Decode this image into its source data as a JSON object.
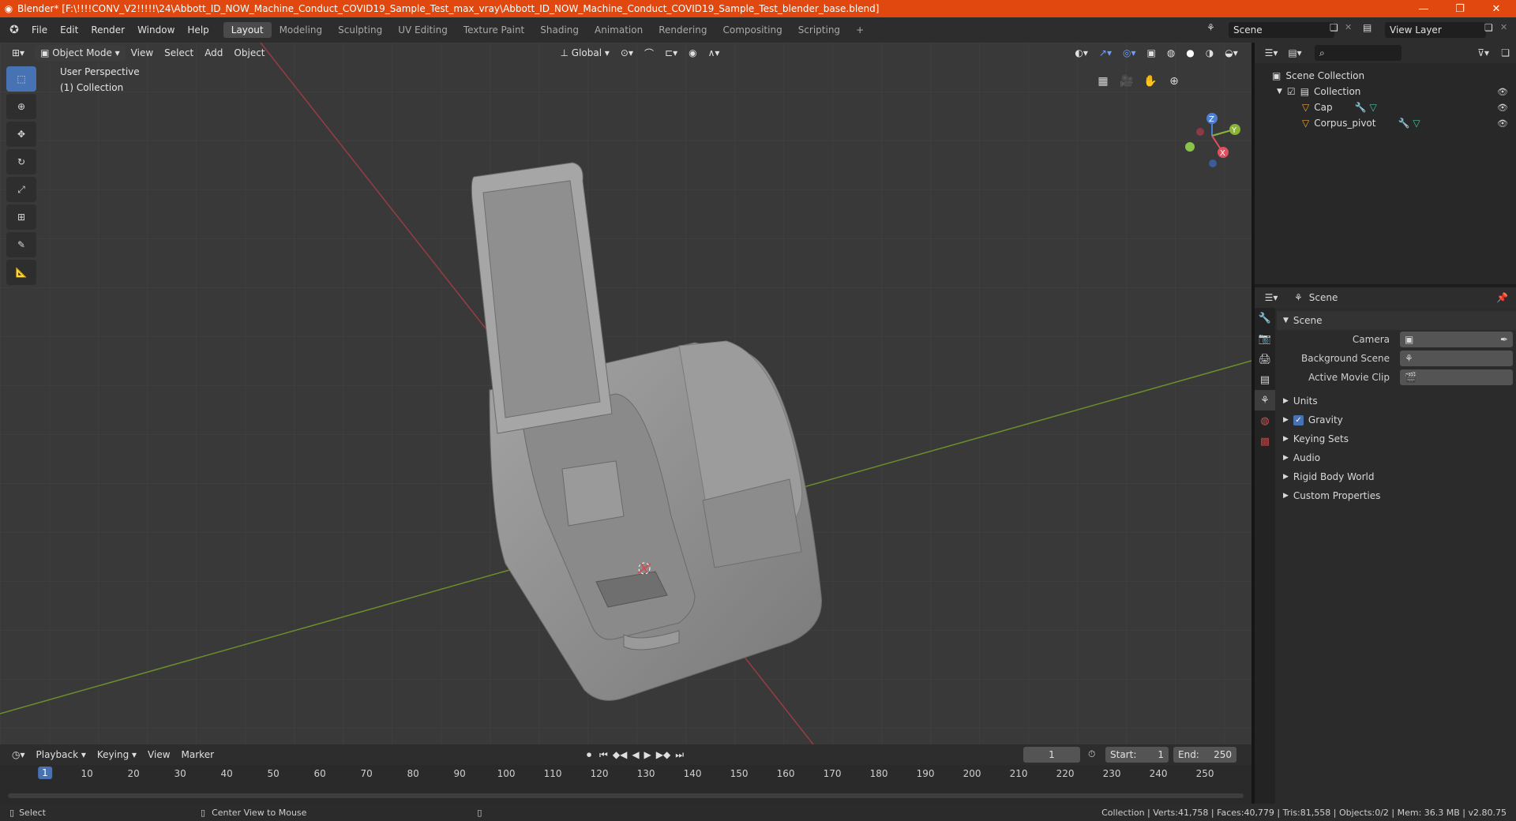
{
  "window": {
    "title": "Blender* [F:\\!!!!CONV_V2!!!!!\\24\\Abbott_ID_NOW_Machine_Conduct_COVID19_Sample_Test_max_vray\\Abbott_ID_NOW_Machine_Conduct_COVID19_Sample_Test_blender_base.blend]",
    "minimize": "—",
    "restore": "❐",
    "close": "✕"
  },
  "menu": [
    "File",
    "Edit",
    "Render",
    "Window",
    "Help"
  ],
  "workspaces": [
    "Layout",
    "Modeling",
    "Sculpting",
    "UV Editing",
    "Texture Paint",
    "Shading",
    "Animation",
    "Rendering",
    "Compositing",
    "Scripting",
    "+"
  ],
  "active_workspace": "Layout",
  "scene_field": "Scene",
  "view_layer_field": "View Layer",
  "viewport": {
    "mode": "Object Mode",
    "menus": [
      "View",
      "Select",
      "Add",
      "Object"
    ],
    "orientation": "Global",
    "perspective_label": "User Perspective",
    "collection_label": "(1) Collection",
    "gizmo": {
      "x": "X",
      "y": "Y",
      "z": "Z"
    }
  },
  "outliner": {
    "root": "Scene Collection",
    "collection": "Collection",
    "objects": [
      "Cap",
      "Corpus_pivot"
    ]
  },
  "properties": {
    "context": "Scene",
    "panel_title": "Scene",
    "fields": [
      {
        "label": "Camera",
        "value": ""
      },
      {
        "label": "Background Scene",
        "value": ""
      },
      {
        "label": "Active Movie Clip",
        "value": ""
      }
    ],
    "subpanels": [
      "Units",
      "Gravity",
      "Keying Sets",
      "Audio",
      "Rigid Body World",
      "Custom Properties"
    ],
    "gravity_checked": true
  },
  "timeline": {
    "menus": [
      "Playback",
      "Keying",
      "View",
      "Marker"
    ],
    "current_frame": "1",
    "start_label": "Start:",
    "start": "1",
    "end_label": "End:",
    "end": "250",
    "ticks": [
      "10",
      "20",
      "30",
      "40",
      "50",
      "60",
      "70",
      "80",
      "90",
      "100",
      "110",
      "120",
      "130",
      "140",
      "150",
      "160",
      "170",
      "180",
      "190",
      "200",
      "210",
      "220",
      "230",
      "240",
      "250"
    ],
    "cursor_frame": "1"
  },
  "statusbar": {
    "left": "Select",
    "middle": "Center View to Mouse",
    "right": "Collection | Verts:41,758 | Faces:40,779 | Tris:81,558 | Objects:0/2 | Mem: 36.3 MB | v2.80.75"
  },
  "colors": {
    "titlebar": "#e0480f",
    "accent": "#4772b3",
    "x_axis": "#e05060",
    "y_axis": "#8bb33a",
    "z_axis": "#4d7fd6"
  }
}
